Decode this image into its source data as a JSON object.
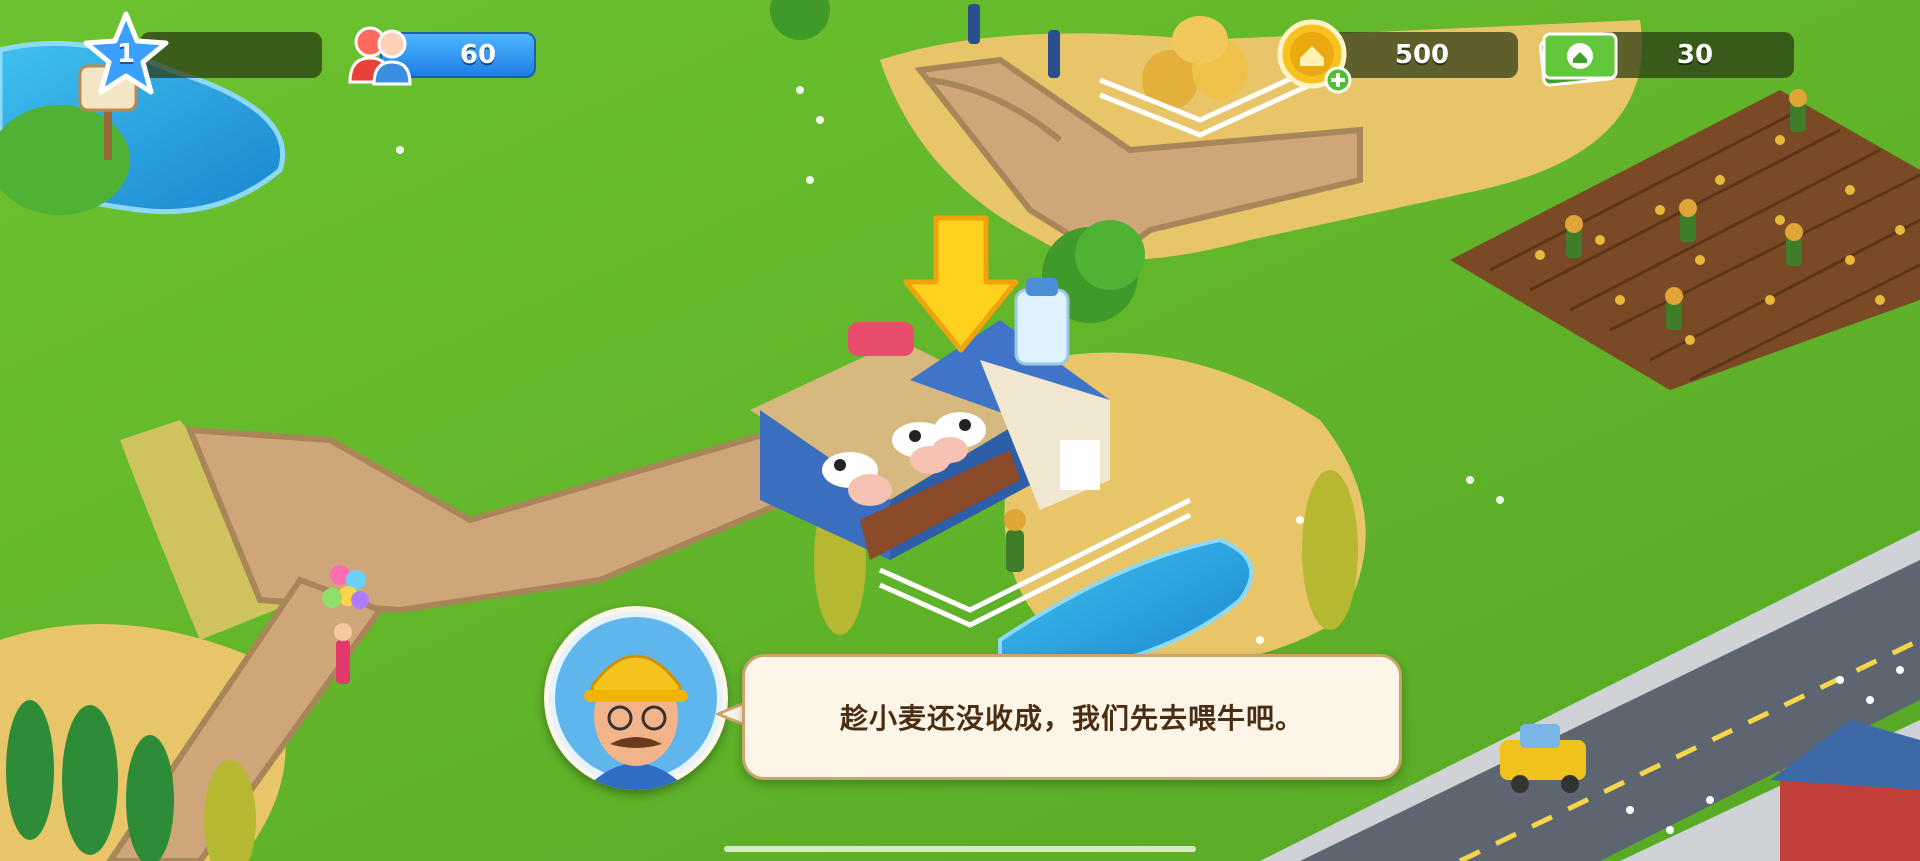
{
  "hud": {
    "level": "1",
    "population": "60",
    "coins": "500",
    "cash": "30",
    "icons": {
      "level": "star-icon",
      "population": "population-icon",
      "coins": "coin-icon",
      "coin_add": "plus-icon",
      "cash": "cash-icon"
    },
    "colors": {
      "population_bar": "#2f8ff0",
      "star": "#3aa0ff",
      "coin": "#f3b51a",
      "cash": "#5cbd3a"
    }
  },
  "dialogue": {
    "text": "趁小麦还没收成，我们先去喂牛吧。",
    "speaker_icon": "farmer-portrait"
  },
  "scene": {
    "target_building": "dairy-farm",
    "pointer_icon": "arrow-down-icon"
  }
}
